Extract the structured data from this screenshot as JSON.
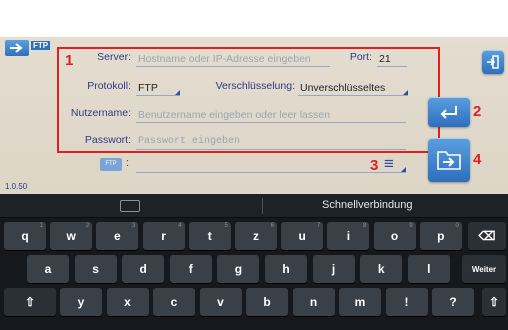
{
  "app": {
    "title": "FTP",
    "version": "1.0.50",
    "server_label": "Server:",
    "server_placeholder": "Hostname oder IP-Adresse eingeben",
    "port_label": "Port:",
    "port_value": "21",
    "protocol_label": "Protokoll:",
    "protocol_value": "FTP",
    "encryption_label": "Verschlüsselung:",
    "encryption_value": "Unverschlüsseltes",
    "user_label": "Nutzername:",
    "user_placeholder": "Benutzername eingeben oder leer lassen",
    "password_label": "Passwort:",
    "password_placeholder": "Passwort eingeben",
    "saved_badge": "FTP",
    "saved_colon": ":",
    "menu_icon_text": "≡",
    "annotations": [
      "1",
      "2",
      "3",
      "4"
    ]
  },
  "keyboard": {
    "suggestion": "Schnellverbindung",
    "row1": [
      {
        "k": "q",
        "h": "1"
      },
      {
        "k": "w",
        "h": "2"
      },
      {
        "k": "e",
        "h": "3"
      },
      {
        "k": "r",
        "h": "4"
      },
      {
        "k": "t",
        "h": "5"
      },
      {
        "k": "z",
        "h": "6"
      },
      {
        "k": "u",
        "h": "7"
      },
      {
        "k": "i",
        "h": "8"
      },
      {
        "k": "o",
        "h": "9"
      },
      {
        "k": "p",
        "h": "0"
      }
    ],
    "row2": [
      "a",
      "s",
      "d",
      "f",
      "g",
      "h",
      "j",
      "k",
      "l"
    ],
    "row3": [
      "y",
      "x",
      "c",
      "v",
      "b",
      "n",
      "m",
      "!",
      "?"
    ],
    "enter_label": "Weiter",
    "backspace": "⌫",
    "shift": "⇧"
  },
  "colors": {
    "accent": "#2e6fbd",
    "annotation": "#e02020",
    "label": "#2f3a86"
  }
}
